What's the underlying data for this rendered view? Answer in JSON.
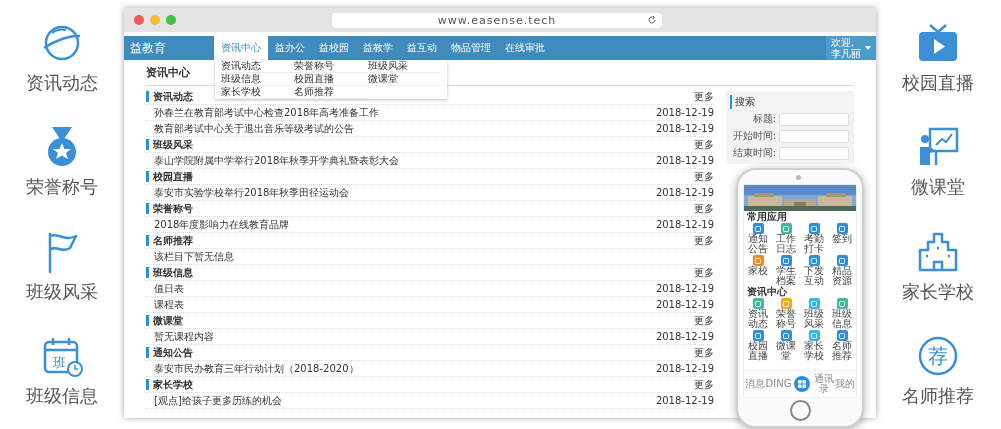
{
  "features_left": [
    {
      "label": "资讯动态",
      "kind": "planet"
    },
    {
      "label": "荣誉称号",
      "kind": "medal"
    },
    {
      "label": "班级风采",
      "kind": "flag"
    },
    {
      "label": "班级信息",
      "kind": "calendar",
      "glyph": "班"
    }
  ],
  "features_right": [
    {
      "label": "校园直播",
      "kind": "tv"
    },
    {
      "label": "微课堂",
      "kind": "teacher"
    },
    {
      "label": "家长学校",
      "kind": "building"
    },
    {
      "label": "名师推荐",
      "kind": "seal",
      "glyph": "荐"
    }
  ],
  "browser": {
    "url": "www.easense.tech"
  },
  "app": {
    "logo": "益教育",
    "nav": [
      {
        "label": "资讯中心",
        "selected": true
      },
      {
        "label": "益办公",
        "selected": false
      },
      {
        "label": "益校园",
        "selected": false
      },
      {
        "label": "益教学",
        "selected": false
      },
      {
        "label": "益互动",
        "selected": false
      },
      {
        "label": "物品管理",
        "selected": false
      },
      {
        "label": "在线审批",
        "selected": false
      }
    ],
    "dropdown": [
      "资讯动态",
      "荣誉称号",
      "班级风采",
      "班级信息",
      "校园直播",
      "微课堂",
      "家长学校",
      "名师推荐"
    ],
    "user": {
      "greeting": "欢迎,",
      "name": "李凡丽"
    },
    "page_title": "资讯中心",
    "sections": [
      {
        "title": "资讯动态",
        "more": "更多",
        "items": [
          {
            "title": "孙春兰在教育部考试中心检查2018年高考准备工作",
            "date": "2018-12-19"
          },
          {
            "title": "教育部考试中心关于退出音乐等级考试的公告",
            "date": "2018-12-19"
          }
        ]
      },
      {
        "title": "班级风采",
        "more": "更多",
        "items": [
          {
            "title": "泰山学院附属中学举行2018年秋季开学典礼暨表彰大会",
            "date": "2018-12-19"
          }
        ]
      },
      {
        "title": "校园直播",
        "more": "更多",
        "items": [
          {
            "title": "泰安市实验学校举行2018年秋季田径运动会",
            "date": "2018-12-19"
          }
        ]
      },
      {
        "title": "荣誉称号",
        "more": "更多",
        "items": [
          {
            "title": "2018年度影响力在线教育品牌",
            "date": "2018-12-19"
          }
        ]
      },
      {
        "title": "名师推荐",
        "more": "更多",
        "items": [
          {
            "title": "该栏目下暂无信息"
          }
        ]
      },
      {
        "title": "班级信息",
        "more": "更多",
        "items": [
          {
            "title": "值日表",
            "date": "2018-12-19"
          },
          {
            "title": "课程表",
            "date": "2018-12-19"
          }
        ]
      },
      {
        "title": "微课堂",
        "more": "更多",
        "items": [
          {
            "title": "暂无课程内容",
            "date": "2018-12-19"
          }
        ]
      },
      {
        "title": "通知公告",
        "more": "更多",
        "items": [
          {
            "title": "泰安市民办教育三年行动计划（2018-2020）",
            "date": "2018-12-19"
          }
        ]
      },
      {
        "title": "家长学校",
        "more": "更多",
        "items": [
          {
            "title": "[观点]给孩子更多历练的机会",
            "date": "2018-12-19"
          }
        ]
      }
    ],
    "search": {
      "title": "搜索",
      "fields": [
        {
          "label": "标题:"
        },
        {
          "label": "开始时间:"
        },
        {
          "label": "结束时间:"
        }
      ]
    }
  },
  "phone": {
    "sections": [
      {
        "title": "常用应用",
        "apps": [
          {
            "label": "通知公告",
            "color": "#2d8fe0"
          },
          {
            "label": "工作日志",
            "color": "#3dbb9a"
          },
          {
            "label": "考勤打卡",
            "color": "#2d8fe0"
          },
          {
            "label": "签到",
            "color": "#2d8fe0"
          },
          {
            "label": "家校",
            "color": "#f08a24"
          },
          {
            "label": "学生档案",
            "color": "#2d8fe0"
          },
          {
            "label": "下发互动",
            "color": "#2d8fe0"
          },
          {
            "label": "精品资源",
            "color": "#2d8fe0"
          }
        ]
      },
      {
        "title": "资讯中心",
        "apps": [
          {
            "label": "资讯动态",
            "color": "#3dbb9a"
          },
          {
            "label": "荣誉称号",
            "color": "#f5a623"
          },
          {
            "label": "班级风采",
            "color": "#35b4ee"
          },
          {
            "label": "班级信息",
            "color": "#3dbb9a"
          },
          {
            "label": "校园直播",
            "color": "#2d8fe0"
          },
          {
            "label": "微课堂",
            "color": "#2d8fe0"
          },
          {
            "label": "家长学校",
            "color": "#35b4ee"
          },
          {
            "label": "名师推荐",
            "color": "#2d8fe0"
          }
        ]
      }
    ],
    "tabs": [
      {
        "label": "消息",
        "selected": false
      },
      {
        "label": "DING",
        "selected": false
      },
      {
        "kind": "home",
        "selected": true
      },
      {
        "label": "通讯录",
        "selected": false
      },
      {
        "label": "我的",
        "selected": false
      }
    ]
  }
}
